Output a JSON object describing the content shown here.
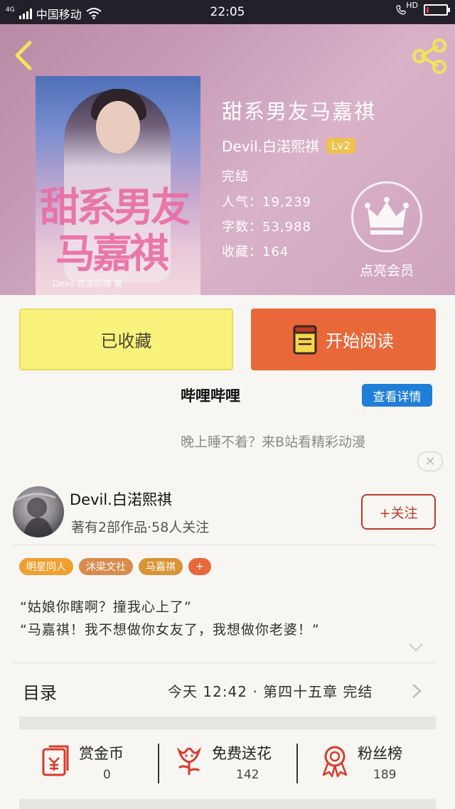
{
  "status_bar": {
    "network": "4G",
    "carrier": "中国移动",
    "time": "22:05",
    "hd": "HD",
    "battery_level": 0.1
  },
  "book": {
    "title": "甜系男友马嘉祺",
    "author": "Devil.白渃熙祺",
    "level": "Lv2",
    "status": "完结",
    "popularity_label": "人气：",
    "popularity": "19,239",
    "words_label": "字数：",
    "words": "53,988",
    "favorites_label": "收藏：",
    "favorites": "164",
    "cover_title_1": "甜系男友",
    "cover_title_2": "马嘉祺",
    "cover_author": "Devil.白渃熙祺 著"
  },
  "vip": {
    "label": "点亮会员",
    "icon": "crown-icon"
  },
  "actions": {
    "collected_label": "已收藏",
    "read_label": "开始阅读"
  },
  "ad": {
    "title": "哔哩哔哩",
    "detail_label": "查看详情",
    "desc": "晚上睡不着？来B站看精彩动漫",
    "close": "✕"
  },
  "writer": {
    "name": "Devil.白渃熙祺",
    "stats": "著有2部作品·58人关注",
    "follow_label": "+关注"
  },
  "tags": [
    {
      "label": "明星同人",
      "color": "#f0a030"
    },
    {
      "label": "沐梁文社",
      "color": "#d98b4e"
    },
    {
      "label": "马嘉祺",
      "color": "#d99436"
    },
    {
      "label": "+",
      "color": "#e8683a"
    }
  ],
  "summary": {
    "line1": "“姑娘你瞎啊？撞我心上了”",
    "line2": "“马嘉祺！我不想做你女友了，我想做你老婆！”"
  },
  "toc": {
    "label": "目录",
    "latest": "今天 12:42 · 第四十五章 完结"
  },
  "stats": [
    {
      "label": "赏金币",
      "value": "0",
      "icon": "red-envelope-icon"
    },
    {
      "label": "免费送花",
      "value": "142",
      "icon": "flower-icon"
    },
    {
      "label": "粉丝榜",
      "value": "189",
      "icon": "medal-icon"
    }
  ],
  "colors": {
    "accent": "#e8683a",
    "collect_bg": "#f9f27c",
    "ad_button": "#1f7fd6",
    "follow": "#c0392b"
  }
}
